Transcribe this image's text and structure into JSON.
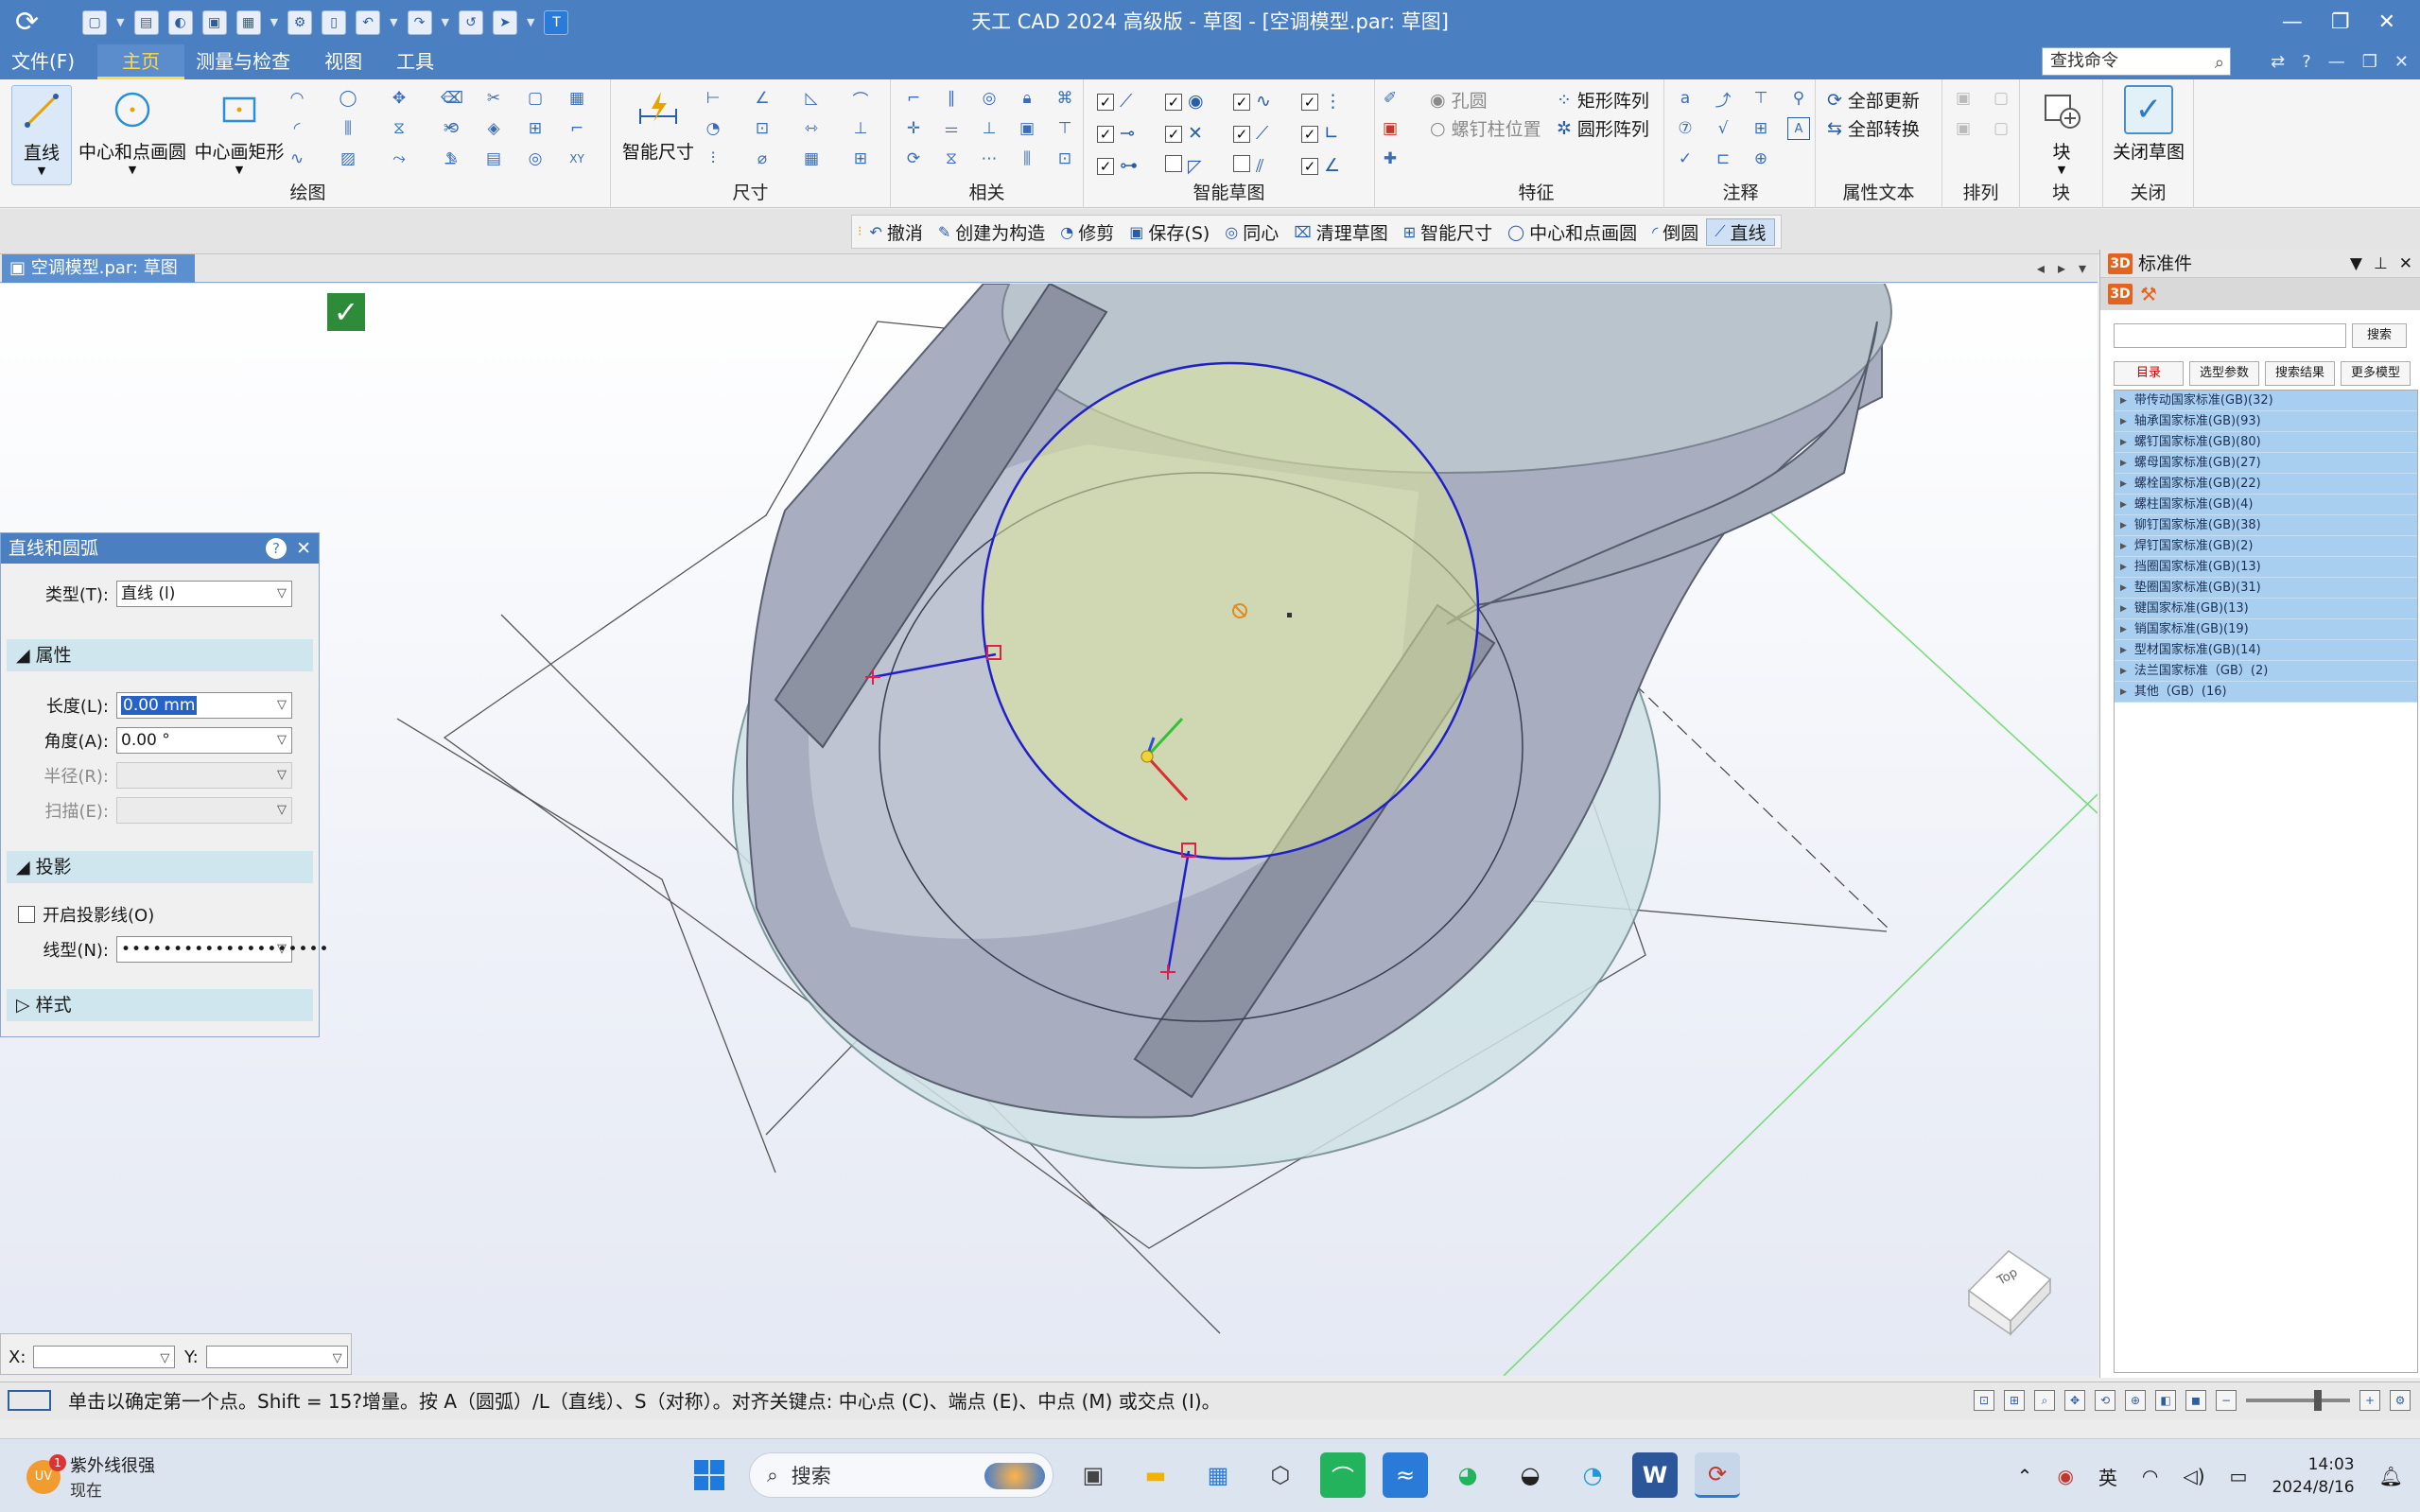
{
  "app": {
    "title": "天工 CAD 2024 高级版 - 草图 - [空调模型.par: 草图]"
  },
  "menu": {
    "items": [
      "文件(F)",
      "主页",
      "测量与检查",
      "视图",
      "工具"
    ],
    "active": "主页",
    "find_placeholder": "查找命令"
  },
  "ribbon": {
    "draw": {
      "label": "绘图",
      "line": "直线",
      "center_circle": "中心和点画圆",
      "center_rect": "中心画矩形"
    },
    "dimension": {
      "label": "尺寸",
      "smart_dim": "智能尺寸"
    },
    "relate": {
      "label": "相关"
    },
    "smart_sketch": {
      "label": "智能草图"
    },
    "feature": {
      "label": "特征",
      "hole": "孔圆",
      "stud": "螺钉柱位置",
      "rect_array": "矩形阵列",
      "circ_array": "圆形阵列"
    },
    "annotation": {
      "label": "注释"
    },
    "property_text": {
      "label": "属性文本",
      "update_all": "全部更新",
      "convert_all": "全部转换"
    },
    "arrange": {
      "label": "排列"
    },
    "block": {
      "label": "块",
      "button": "块"
    },
    "close": {
      "label": "关闭",
      "button": "关闭草图"
    }
  },
  "command_bar": {
    "items": [
      "撤消",
      "创建为构造",
      "修剪",
      "保存(S)",
      "同心",
      "清理草图",
      "智能尺寸",
      "中心和点画圆",
      "倒圆",
      "直线"
    ],
    "active": "直线"
  },
  "doc_tab": "空调模型.par: 草图",
  "dialog": {
    "title": "直线和圆弧",
    "type_label": "类型(T):",
    "type_value": "直线 (l)",
    "attributes_section": "属性",
    "length_label": "长度(L):",
    "length_value": "0.00 mm",
    "angle_label": "角度(A):",
    "angle_value": "0.00 °",
    "radius_label": "半径(R):",
    "sweep_label": "扫描(E):",
    "projection_section": "投影",
    "projection_checkbox": "开启投影线(O)",
    "linetype_label": "线型(N):",
    "style_section": "样式"
  },
  "coords": {
    "x_label": "X:",
    "y_label": "Y:"
  },
  "right_panel": {
    "title": "标准件",
    "search_button": "搜索",
    "tabs": [
      "目录",
      "选型参数",
      "搜索结果",
      "更多模型"
    ],
    "active_tab": "目录",
    "items": [
      "带传动国家标准(GB)(32)",
      "轴承国家标准(GB)(93)",
      "螺钉国家标准(GB)(80)",
      "螺母国家标准(GB)(27)",
      "螺栓国家标准(GB)(22)",
      "螺柱国家标准(GB)(4)",
      "铆钉国家标准(GB)(38)",
      "焊钉国家标准(GB)(2)",
      "挡圈国家标准(GB)(13)",
      "垫圈国家标准(GB)(31)",
      "键国家标准(GB)(13)",
      "销国家标准(GB)(19)",
      "型材国家标准(GB)(14)",
      "法兰国家标准（GB）(2)",
      "其他（GB）(16)"
    ]
  },
  "status": {
    "prompt": "单击以确定第一个点。Shift = 15?增量。按 A（圆弧）/L（直线）、S（对称）。对齐关键点: 中心点 (C)、端点 (E)、中点 (M) 或交点 (I)。"
  },
  "view_cube": {
    "face_label": "Top"
  },
  "taskbar": {
    "weather_title": "紫外线很强",
    "weather_sub": "现在",
    "weather_badge": "1",
    "search_text": "搜索",
    "ime": "英",
    "time": "14:03",
    "date": "2024/8/16"
  },
  "colors": {
    "title_bar": "#4a7fc1",
    "active_menu": "#ffd84a",
    "sketch_circle": "#2020c8",
    "sketch_point": "#e0204a",
    "model_fill": "#9aa3b8"
  }
}
